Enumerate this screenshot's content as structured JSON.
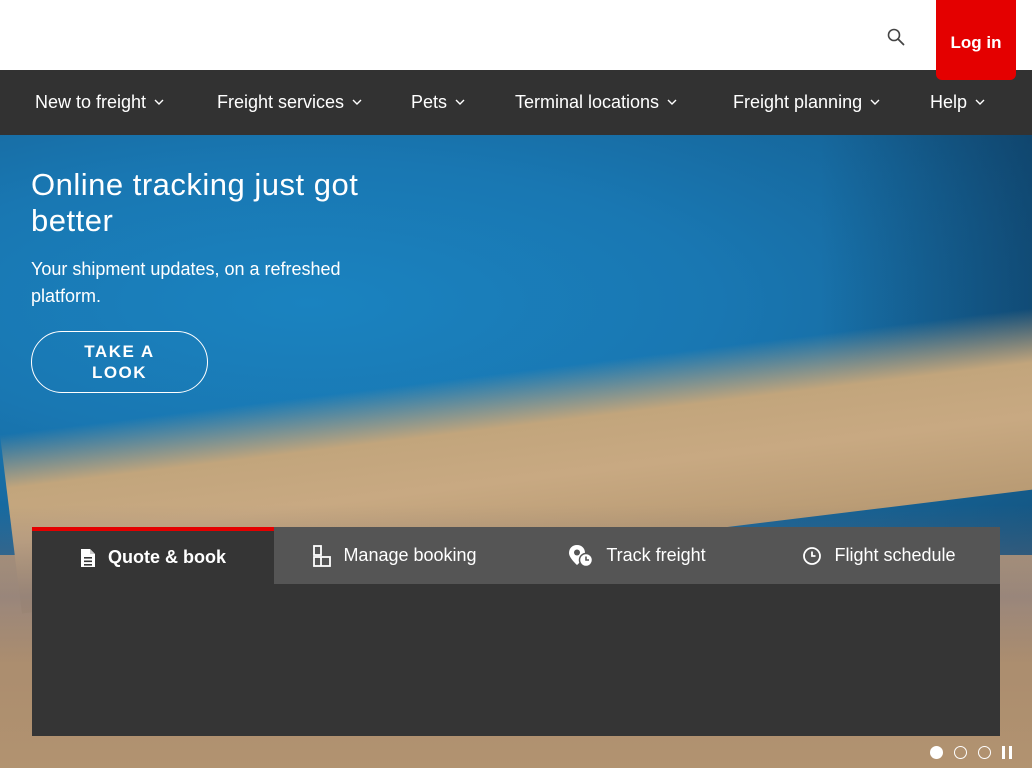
{
  "header": {
    "search_icon": "search-icon",
    "login_label": "Log in",
    "accent_color": "#e40000"
  },
  "nav": {
    "items": [
      {
        "label": "New to freight"
      },
      {
        "label": "Freight services"
      },
      {
        "label": "Pets"
      },
      {
        "label": "Terminal locations"
      },
      {
        "label": "Freight planning"
      },
      {
        "label": "Help"
      }
    ]
  },
  "hero": {
    "title": "Online tracking just got better",
    "subtitle": "Your shipment updates, on a refreshed platform.",
    "cta_label": "TAKE A LOOK"
  },
  "widget": {
    "tabs": [
      {
        "label": "Quote & book",
        "icon": "document-icon",
        "active": true
      },
      {
        "label": "Manage booking",
        "icon": "manage-booking-icon",
        "active": false
      },
      {
        "label": "Track freight",
        "icon": "track-freight-icon",
        "active": false
      },
      {
        "label": "Flight schedule",
        "icon": "clock-icon",
        "active": false
      }
    ]
  },
  "carousel": {
    "slides_total": 3,
    "current_slide": 1,
    "pause_icon": "pause-icon"
  }
}
